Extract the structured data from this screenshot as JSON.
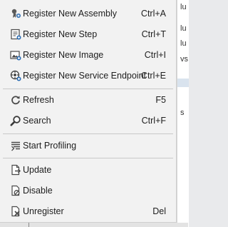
{
  "background": {
    "fragments": [
      "lu",
      "lu",
      "lu",
      "vs",
      "s"
    ]
  },
  "menu": {
    "items": [
      {
        "label": "Register New Assembly",
        "shortcut": "Ctrl+A",
        "icon": "register-assembly-icon"
      },
      {
        "label": "Register New Step",
        "shortcut": "Ctrl+T",
        "icon": "register-step-icon"
      },
      {
        "label": "Register New Image",
        "shortcut": "Ctrl+I",
        "icon": "register-image-icon"
      },
      {
        "label": "Register New Service Endpoint",
        "shortcut": "Ctrl+E",
        "icon": "register-endpoint-icon"
      },
      {
        "label": "Refresh",
        "shortcut": "F5",
        "icon": "refresh-icon"
      },
      {
        "label": "Search",
        "shortcut": "Ctrl+F",
        "icon": "search-icon"
      },
      {
        "label": "Start Profiling",
        "shortcut": "",
        "icon": "profiling-icon"
      },
      {
        "label": "Update",
        "shortcut": "",
        "icon": "update-icon"
      },
      {
        "label": "Disable",
        "shortcut": "",
        "icon": "disable-icon"
      },
      {
        "label": "Unregister",
        "shortcut": "Del",
        "icon": "unregister-icon"
      }
    ]
  },
  "colors": {
    "menu_bg": "#f2f2f2",
    "icon_dark": "#4a4a4a",
    "icon_blue": "#2f6fb5",
    "icon_red": "#c42b1c"
  }
}
